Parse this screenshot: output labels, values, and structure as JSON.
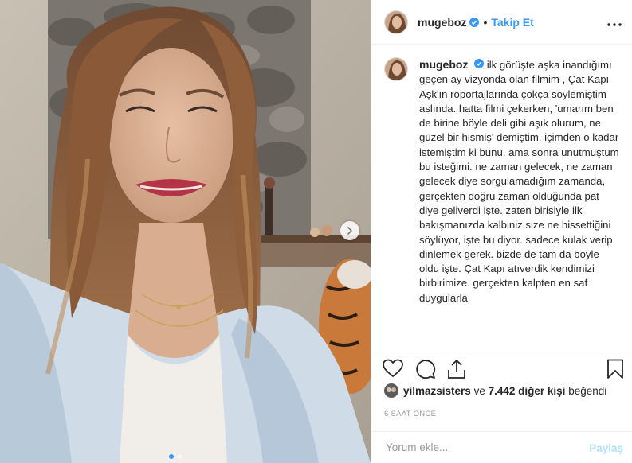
{
  "header": {
    "username": "mugeboz",
    "follow_label": "Takip Et",
    "separator": "•"
  },
  "caption": {
    "username": "mugeboz",
    "text": "ilk görüşte aşka inandığımı geçen ay vizyonda olan filmim , Çat Kapı Aşk'ın röportajlarında çokça söylemiştim aslında. hatta filmi çekerken, 'umarım ben de birine böyle deli gibi aşık olurum, ne güzel bir hismiş' demiştim. içimden o kadar istemiştim ki bunu. ama sonra unutmuştum bu isteğimi. ne zaman gelecek, ne zaman gelecek diye sorgulamadığım zamanda, gerçekten doğru zaman olduğunda pat diye geliverdi işte. zaten birisiyle ilk bakışmanızda kalbiniz size ne hissettiğini söylüyor, işte bu diyor. sadece kulak verip dinlemek gerek. bizde de tam da böyle oldu işte. Çat Kapı atıverdik kendimizi birbirimize. gerçekten kalpten en saf duygularla"
  },
  "likes": {
    "liker": "yilmazsisters",
    "connector": "ve",
    "others": "7.442 diğer kişi",
    "suffix": "beğendi"
  },
  "timestamp": "6 SAAT ÖNCE",
  "comment": {
    "placeholder": "Yorum ekle...",
    "post_label": "Paylaş"
  },
  "carousel": {
    "total": 2,
    "current": 1
  },
  "icons": {
    "verified": "verified-badge-icon",
    "more": "more-options-icon",
    "like": "heart-icon",
    "comment": "comment-icon",
    "share": "share-icon",
    "save": "bookmark-icon",
    "next": "chevron-right-icon"
  },
  "colors": {
    "accent": "#3897f0",
    "text": "#262626",
    "muted": "#999999",
    "post_disabled": "#b2dffc"
  }
}
